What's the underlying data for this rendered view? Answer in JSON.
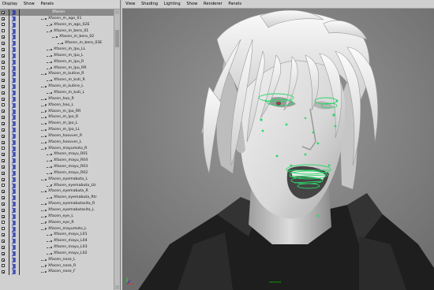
{
  "outliner": {
    "menu": [
      "Display",
      "Show",
      "Panels"
    ],
    "rows": [
      {
        "label": "Xfacen",
        "depth": 0,
        "selected": true
      },
      {
        "label": "Xfacen_m_ago_01",
        "depth": 1
      },
      {
        "label": "Xfacen_m_ago_02E",
        "depth": 2
      },
      {
        "label": "Xfacen_m_bero_01",
        "depth": 2
      },
      {
        "label": "Xfacen_m_bero_02",
        "depth": 3
      },
      {
        "label": "Xfacen_m_bero_03E",
        "depth": 4
      },
      {
        "label": "Xfacen_m_lpu_LL",
        "depth": 2
      },
      {
        "label": "Xfacen_m_lpu_L",
        "depth": 2
      },
      {
        "label": "Xfacen_m_lpu_R",
        "depth": 2
      },
      {
        "label": "Xfacen_m_lpu_RR",
        "depth": 2
      },
      {
        "label": "Xfacen_m_kutine_R",
        "depth": 1
      },
      {
        "label": "Xfacen_m_kuti_R",
        "depth": 2
      },
      {
        "label": "Xfacen_m_kutine_L",
        "depth": 1
      },
      {
        "label": "Xfacen_m_kuti_L",
        "depth": 2
      },
      {
        "label": "Xfacen_hoo_R",
        "depth": 1
      },
      {
        "label": "Xfacen_hoo_L",
        "depth": 1
      },
      {
        "label": "Xfacen_m_lpo_RR",
        "depth": 1
      },
      {
        "label": "Xfacen_m_lpo_R",
        "depth": 1
      },
      {
        "label": "Xfacen_m_lpo_L",
        "depth": 1
      },
      {
        "label": "Xfacen_m_lpo_LL",
        "depth": 1
      },
      {
        "label": "Xfacen_hoovver_R",
        "depth": 1
      },
      {
        "label": "Xfacen_hoovver_L",
        "depth": 1
      },
      {
        "label": "Xfacen_mayumoto_R",
        "depth": 1
      },
      {
        "label": "Xfacen_mayu_R01",
        "depth": 2
      },
      {
        "label": "Xfacen_mayu_R04",
        "depth": 2
      },
      {
        "label": "Xfacen_mayu_R03",
        "depth": 2
      },
      {
        "label": "Xfacen_mayu_R02",
        "depth": 2
      },
      {
        "label": "Xfacen_eyemabuta_L",
        "depth": 1
      },
      {
        "label": "Xfacen_eyemabuta_Ltr",
        "depth": 2
      },
      {
        "label": "Xfacen_eyemabuta_R",
        "depth": 1
      },
      {
        "label": "Xfacen_eyemabuta_Rtr",
        "depth": 2
      },
      {
        "label": "Xfacen_eyemabutasita_R",
        "depth": 1
      },
      {
        "label": "Xfacen_eyemabutasita_L",
        "depth": 1
      },
      {
        "label": "Xfacen_eye_L",
        "depth": 1
      },
      {
        "label": "Xfacen_eye_R",
        "depth": 1
      },
      {
        "label": "Xfacen_mayumoto_L",
        "depth": 1
      },
      {
        "label": "Xfacen_mayu_L01",
        "depth": 2
      },
      {
        "label": "Xfacen_mayu_L04",
        "depth": 2
      },
      {
        "label": "Xfacen_mayu_L03",
        "depth": 2
      },
      {
        "label": "Xfacen_mayu_L02",
        "depth": 2
      },
      {
        "label": "Xfacen_nose_L",
        "depth": 1
      },
      {
        "label": "Xfacen_nose_R",
        "depth": 1
      },
      {
        "label": "Xfacen_nose_F",
        "depth": 1
      }
    ]
  },
  "viewport": {
    "menu": [
      "View",
      "Shading",
      "Lighting",
      "Show",
      "Renderer",
      "Panels"
    ],
    "camera_label": "camera1",
    "colors": {
      "background": "#8a8a8a",
      "skin": "#e6e6e6",
      "hair": "#f4f4f4",
      "coat": "#1e1e1e",
      "rig": "#2bd66a"
    }
  }
}
